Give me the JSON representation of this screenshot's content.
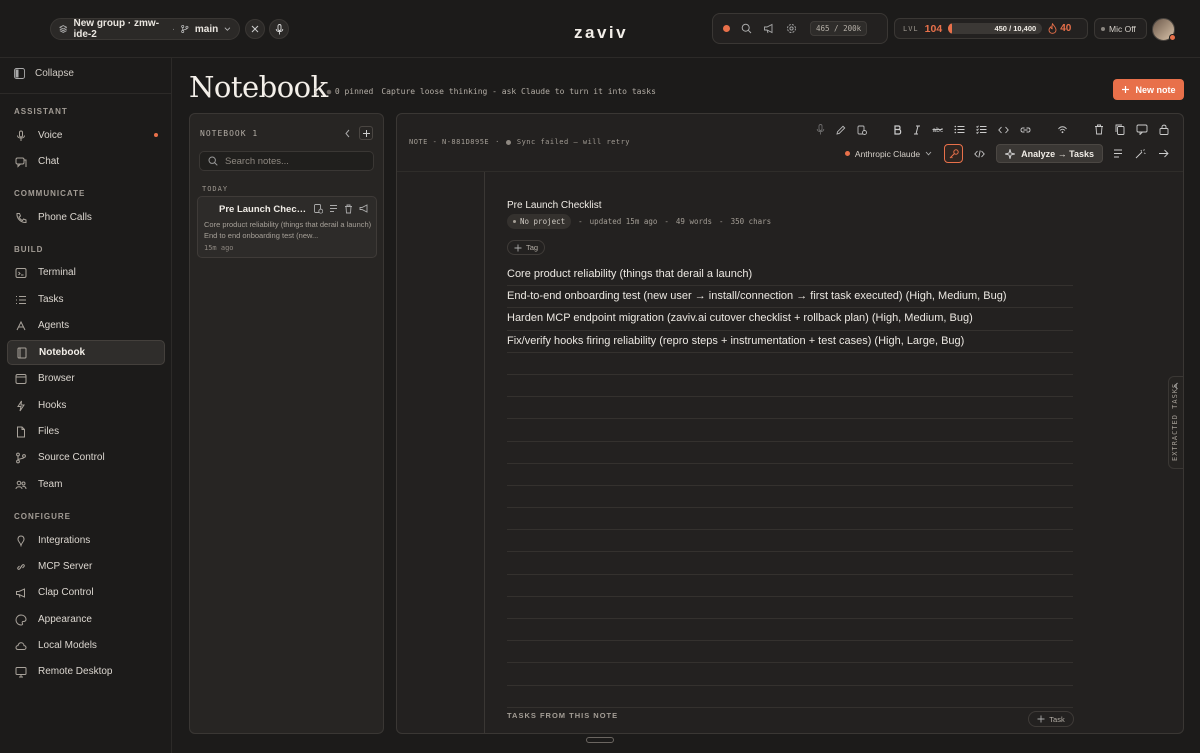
{
  "topbar": {
    "group_label": "New group · zmw-ide-2",
    "branch": "main",
    "logo": "zaviv",
    "tokens": "465 / 200k",
    "level_label": "LVL",
    "level_value": "104",
    "xp_text": "450 / 10,400",
    "xp_fraction": 0.043,
    "streak": "40",
    "mic_label": "Mic Off"
  },
  "sidebar": {
    "collapse_label": "Collapse",
    "sections": {
      "assistant": "ASSISTANT",
      "communicate": "COMMUNICATE",
      "build": "BUILD",
      "configure": "CONFIGURE"
    },
    "items": [
      {
        "label": "Voice",
        "icon": "mic-icon"
      },
      {
        "label": "Chat",
        "icon": "chat-icon"
      },
      {
        "label": "Phone Calls",
        "icon": "phone-icon"
      },
      {
        "label": "Terminal",
        "icon": "terminal-icon"
      },
      {
        "label": "Tasks",
        "icon": "tasks-icon"
      },
      {
        "label": "Agents",
        "icon": "agents-icon"
      },
      {
        "label": "Notebook",
        "icon": "notebook-icon"
      },
      {
        "label": "Browser",
        "icon": "browser-icon"
      },
      {
        "label": "Hooks",
        "icon": "hooks-icon"
      },
      {
        "label": "Files",
        "icon": "files-icon"
      },
      {
        "label": "Source Control",
        "icon": "branch-icon"
      },
      {
        "label": "Team",
        "icon": "team-icon"
      },
      {
        "label": "Integrations",
        "icon": "plug-icon"
      },
      {
        "label": "MCP Server",
        "icon": "link-icon"
      },
      {
        "label": "Clap Control",
        "icon": "megaphone-icon"
      },
      {
        "label": "Appearance",
        "icon": "palette-icon"
      },
      {
        "label": "Local Models",
        "icon": "cloud-icon"
      },
      {
        "label": "Remote Desktop",
        "icon": "monitor-icon"
      }
    ]
  },
  "header": {
    "title": "Notebook",
    "count": "1",
    "pinned": "0 pinned",
    "subtitle": "Capture loose thinking - ask Claude to turn it into tasks",
    "new_note": "New note"
  },
  "list": {
    "heading": "NOTEBOOK 1",
    "search_placeholder": "Search notes...",
    "day_label": "TODAY",
    "notes": [
      {
        "title": "Pre Launch Checklist",
        "preview": "Core product reliability (things that derail a launch) End to end onboarding test (new...",
        "ago": "15m ago"
      }
    ]
  },
  "editor": {
    "note_id": "NOTE - N-881D895E",
    "sync_status": "Sync failed — will retry",
    "model": "Anthropic Claude",
    "analyze": "Analyze → Tasks",
    "title": "Pre Launch Checklist",
    "project": "No project",
    "updated": "updated 15m ago",
    "words": "49 words",
    "chars": "350 chars",
    "tag_label": "Tag",
    "lines": [
      "Core product reliability (things that derail a launch)",
      "End-to-end onboarding test (new user → install/connection → first task executed) (High, Medium, Bug)",
      "Harden MCP endpoint migration (zaviv.ai cutover checklist + rollback plan) (High, Medium, Bug)",
      "Fix/verify hooks firing reliability (repro steps + instrumentation + test cases) (High, Large, Bug)"
    ],
    "tasks_heading": "TASKS FROM THIS NOTE",
    "task_button": "Task",
    "extracted_tab": "EXTRACTED TASKS"
  },
  "colors": {
    "accent": "#e8704a",
    "background": "#1c1b1a",
    "panel": "#272523"
  }
}
